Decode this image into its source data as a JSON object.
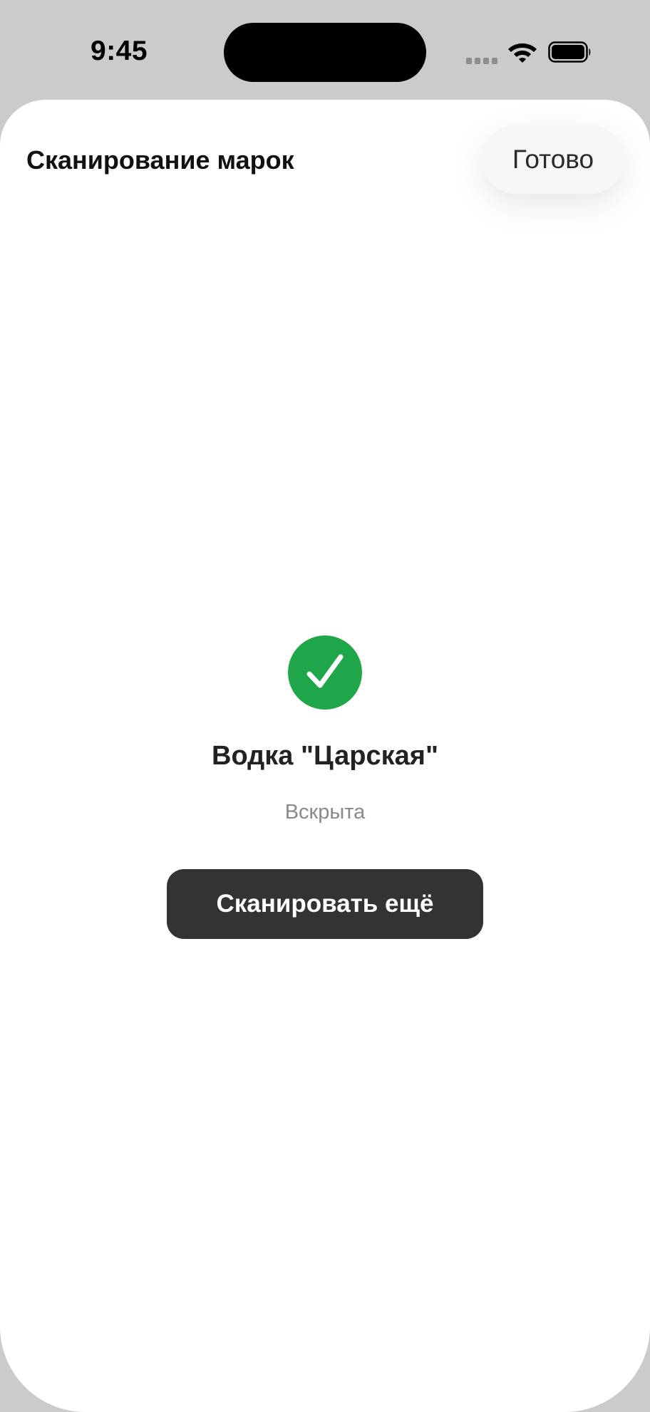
{
  "status_bar": {
    "time": "9:45",
    "icons": [
      "cellular-signal-icon",
      "wifi-icon",
      "battery-icon"
    ]
  },
  "sheet": {
    "title": "Сканирование марок",
    "done_label": "Готово"
  },
  "result": {
    "icon": "checkmark-circle-icon",
    "product_name": "Водка \"Царская\"",
    "status": "Вскрыта",
    "scan_again_label": "Сканировать ещё"
  },
  "colors": {
    "success": "#1fa64a",
    "button_dark": "#333333",
    "background": "#cbcbcb",
    "sheet": "#ffffff"
  }
}
